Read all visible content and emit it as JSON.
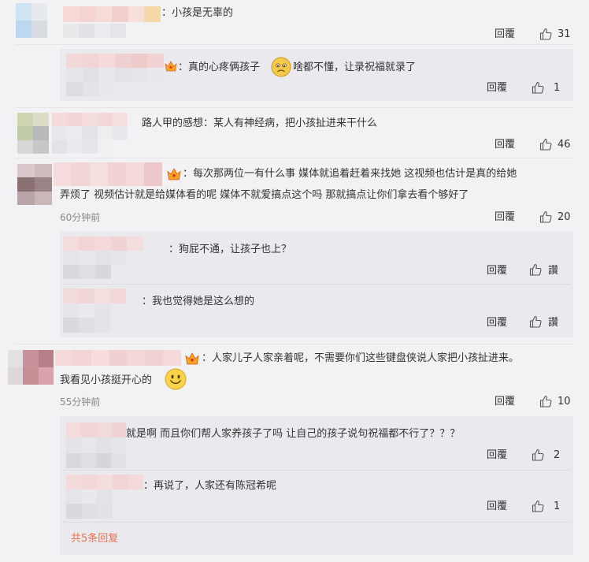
{
  "comments": [
    {
      "text": "：小孩是无辜的",
      "reply_label": "回覆",
      "likes": "31",
      "replies": [
        {
          "text": "：真的心疼俩孩子",
          "text_after": "啥都不懂，让录祝福就录了",
          "reply_label": "回覆",
          "likes": "1"
        }
      ]
    },
    {
      "text": "路人甲的感想：某人有神经病，把小孩扯进来干什么",
      "reply_label": "回覆",
      "likes": "46"
    },
    {
      "text_line1": "：每次那两位一有什么事 媒体就追着赶着来找她 这视频也估计是真的给她",
      "text_line2": "弄烦了 视频估计就是给媒体看的呢 媒体不就爱搞点这个吗 那就搞点让你们拿去看个够好了",
      "time": "60分钟前",
      "reply_label": "回覆",
      "likes": "20",
      "replies": [
        {
          "text": "：狗屁不通，让孩子也上？",
          "reply_label": "回覆",
          "like_text": "讚"
        },
        {
          "text": "：我也觉得她是这么想的",
          "reply_label": "回覆",
          "like_text": "讚"
        }
      ]
    },
    {
      "text_line1": "：人家儿子人家亲着呢，不需要你们这些键盘侠说人家把小孩扯进来。",
      "text_line2": "我看见小孩挺开心的",
      "time": "55分钟前",
      "reply_label": "回覆",
      "likes": "10",
      "replies": [
        {
          "text": "就是啊 而且你们帮人家养孩子了吗 让自己的孩子说句祝福都不行了？？？",
          "reply_label": "回覆",
          "likes": "2"
        },
        {
          "text": "：再说了，人家还有陈冠希呢",
          "reply_label": "回覆",
          "likes": "1"
        }
      ],
      "more_label": "共5条回复"
    }
  ],
  "colors": {
    "background": "#f2f2f5",
    "nested_background": "#e9e9ee",
    "link_orange": "#eb7350",
    "meta_gray": "#888888"
  },
  "icons": [
    "thumbs-up-icon",
    "crown-icon",
    "sad-emoji-icon",
    "smile-emoji-icon"
  ]
}
